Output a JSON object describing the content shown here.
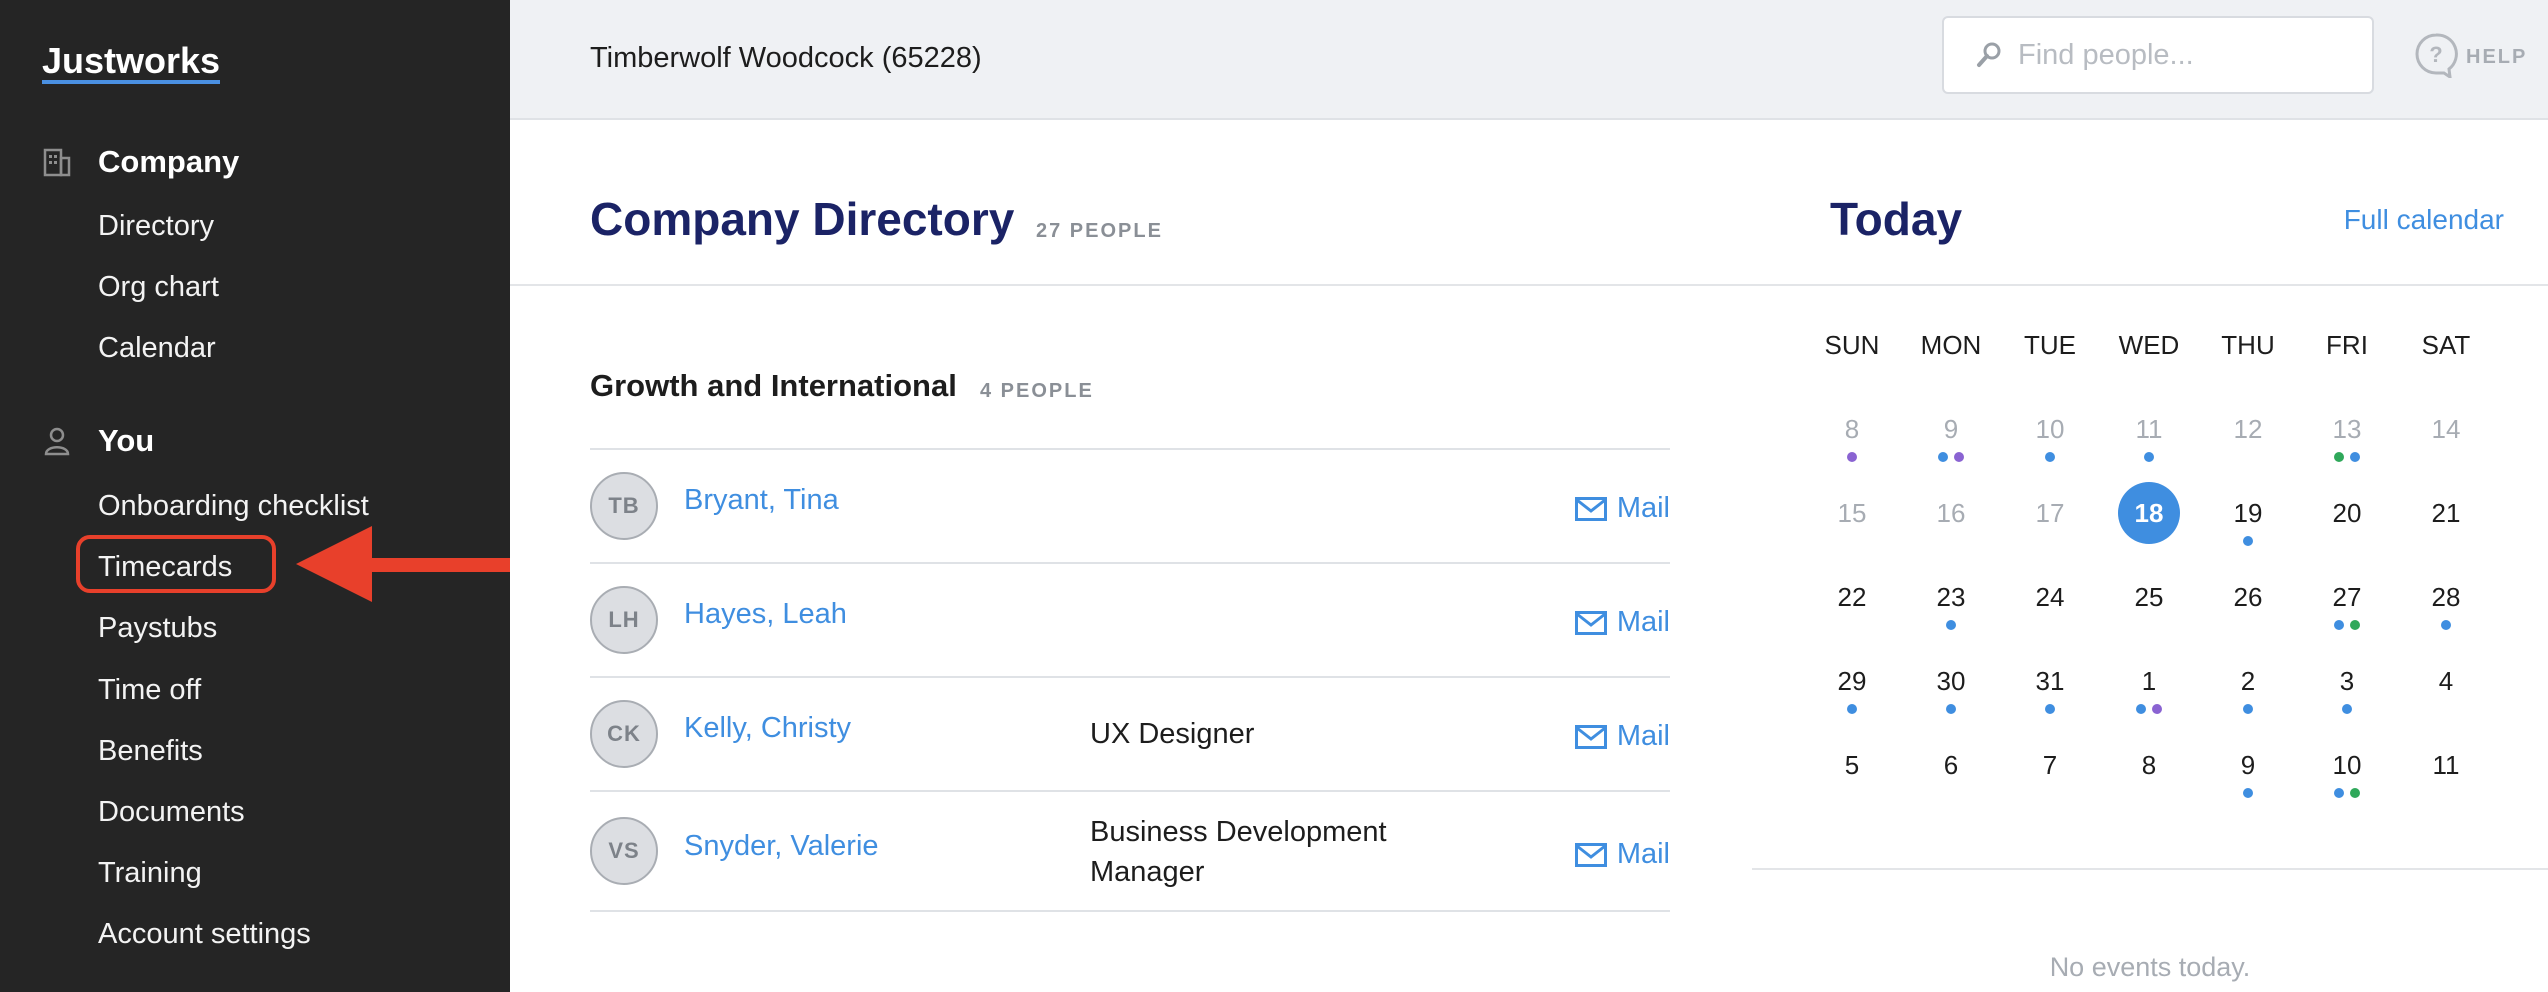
{
  "sidebar": {
    "logo": "Justworks",
    "sections": [
      {
        "title": "Company",
        "icon": "building-icon",
        "items": [
          "Directory",
          "Org chart",
          "Calendar"
        ]
      },
      {
        "title": "You",
        "icon": "person-icon",
        "items": [
          "Onboarding checklist",
          "Timecards",
          "Paystubs",
          "Time off",
          "Benefits",
          "Documents",
          "Training",
          "Account settings"
        ]
      }
    ],
    "highlighted_item": "Timecards"
  },
  "header": {
    "company": "Timberwolf Woodcock (65228)",
    "search_placeholder": "Find people...",
    "help_label": "HELP"
  },
  "directory": {
    "title": "Company Directory",
    "count": "27 PEOPLE",
    "group": {
      "name": "Growth and International",
      "count": "4 PEOPLE",
      "people": [
        {
          "initials": "TB",
          "name": "Bryant, Tina",
          "title": "",
          "mail": "Mail"
        },
        {
          "initials": "LH",
          "name": "Hayes, Leah",
          "title": "",
          "mail": "Mail"
        },
        {
          "initials": "CK",
          "name": "Kelly, Christy",
          "title": "UX Designer",
          "mail": "Mail"
        },
        {
          "initials": "VS",
          "name": "Snyder, Valerie",
          "title": "Business Development Manager",
          "mail": "Mail"
        }
      ]
    }
  },
  "today": {
    "title": "Today",
    "full_calendar": "Full calendar",
    "weekdays": [
      "SUN",
      "MON",
      "TUE",
      "WED",
      "THU",
      "FRI",
      "SAT"
    ],
    "weeks": [
      [
        {
          "d": "8",
          "m": true,
          "dots": [
            "purple"
          ]
        },
        {
          "d": "9",
          "m": true,
          "dots": [
            "blue",
            "purple"
          ]
        },
        {
          "d": "10",
          "m": true,
          "dots": [
            "blue"
          ]
        },
        {
          "d": "11",
          "m": true,
          "dots": [
            "blue"
          ]
        },
        {
          "d": "12",
          "m": true,
          "dots": []
        },
        {
          "d": "13",
          "m": true,
          "dots": [
            "green",
            "blue"
          ]
        },
        {
          "d": "14",
          "m": true,
          "dots": []
        }
      ],
      [
        {
          "d": "15",
          "m": true,
          "dots": []
        },
        {
          "d": "16",
          "m": true,
          "dots": []
        },
        {
          "d": "17",
          "m": true,
          "dots": []
        },
        {
          "d": "18",
          "m": false,
          "sel": true,
          "dots": []
        },
        {
          "d": "19",
          "m": false,
          "dots": [
            "blue"
          ]
        },
        {
          "d": "20",
          "m": false,
          "dots": []
        },
        {
          "d": "21",
          "m": false,
          "dots": []
        }
      ],
      [
        {
          "d": "22",
          "m": false,
          "dots": []
        },
        {
          "d": "23",
          "m": false,
          "dots": [
            "blue"
          ]
        },
        {
          "d": "24",
          "m": false,
          "dots": []
        },
        {
          "d": "25",
          "m": false,
          "dots": []
        },
        {
          "d": "26",
          "m": false,
          "dots": []
        },
        {
          "d": "27",
          "m": false,
          "dots": [
            "blue",
            "green"
          ]
        },
        {
          "d": "28",
          "m": false,
          "dots": [
            "blue"
          ]
        }
      ],
      [
        {
          "d": "29",
          "m": false,
          "dots": [
            "blue"
          ]
        },
        {
          "d": "30",
          "m": false,
          "dots": [
            "blue"
          ]
        },
        {
          "d": "31",
          "m": false,
          "dots": [
            "blue"
          ]
        },
        {
          "d": "1",
          "m": false,
          "dots": [
            "blue",
            "purple"
          ]
        },
        {
          "d": "2",
          "m": false,
          "dots": [
            "blue"
          ]
        },
        {
          "d": "3",
          "m": false,
          "dots": [
            "blue"
          ]
        },
        {
          "d": "4",
          "m": false,
          "dots": []
        }
      ],
      [
        {
          "d": "5",
          "m": false,
          "dots": []
        },
        {
          "d": "6",
          "m": false,
          "dots": []
        },
        {
          "d": "7",
          "m": false,
          "dots": []
        },
        {
          "d": "8",
          "m": false,
          "dots": []
        },
        {
          "d": "9",
          "m": false,
          "dots": [
            "blue"
          ]
        },
        {
          "d": "10",
          "m": false,
          "dots": [
            "blue",
            "green"
          ]
        },
        {
          "d": "11",
          "m": false,
          "dots": []
        }
      ]
    ],
    "no_events": "No events today."
  },
  "colors": {
    "accent_blue": "#3f8ee0",
    "navy": "#1b2366",
    "highlight_red": "#e8402b",
    "dot_blue": "#3f8ee0",
    "dot_purple": "#8a63d2",
    "dot_green": "#2fa85a"
  }
}
